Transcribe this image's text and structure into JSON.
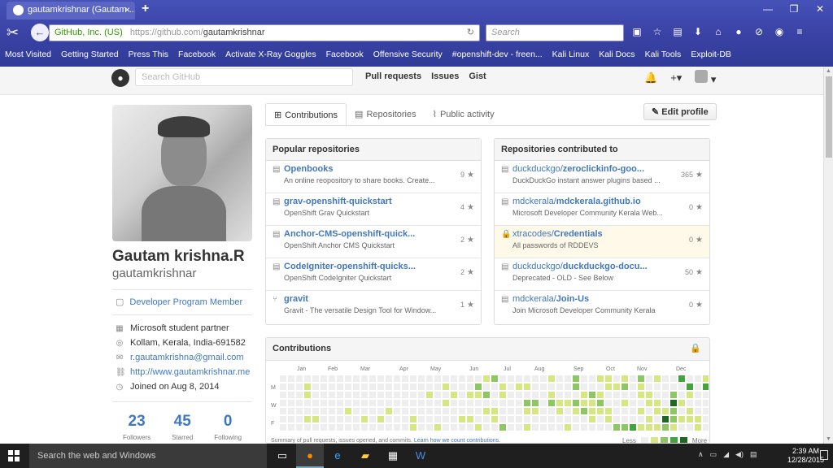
{
  "browser": {
    "tab_title": "gautamkrishnar (Gautam ...",
    "url_identity": "GitHub, Inc. (US)",
    "url_scheme_host": "https://github.com/",
    "url_path": "gautamkrishnar",
    "search_placeholder": "Search",
    "bookmarks": [
      "Most Visited",
      "Getting Started",
      "Press This",
      "Facebook",
      "Activate X-Ray Goggles",
      "Facebook",
      "Offensive Security",
      "#openshift-dev - freen...",
      "Kali Linux",
      "Kali Docs",
      "Kali Tools",
      "Exploit-DB"
    ]
  },
  "github_header": {
    "search_placeholder": "Search GitHub",
    "nav": [
      "Pull requests",
      "Issues",
      "Gist"
    ],
    "plus": "+▾"
  },
  "profile": {
    "fullname": "Gautam krishna.R",
    "username": "gautamkrishnar",
    "badge": "Developer Program Member",
    "details": [
      {
        "icon": "organization-icon",
        "text": "Microsoft student partner",
        "link": false
      },
      {
        "icon": "location-icon",
        "text": "Kollam, Kerala, India-691582",
        "link": false
      },
      {
        "icon": "mail-icon",
        "text": "r.gautamkrishna@gmail.com",
        "link": true
      },
      {
        "icon": "link-icon",
        "text": "http://www.gautamkrishnar.me",
        "link": true
      },
      {
        "icon": "clock-icon",
        "text": "Joined on Aug 8, 2014",
        "link": false
      }
    ],
    "stats": [
      {
        "value": "23",
        "label": "Followers"
      },
      {
        "value": "45",
        "label": "Starred"
      },
      {
        "value": "0",
        "label": "Following"
      }
    ]
  },
  "tabs": [
    "Contributions",
    "Repositories",
    "Public activity"
  ],
  "edit_profile": "Edit profile",
  "popular": {
    "title": "Popular repositories",
    "items": [
      {
        "name": "Openbooks",
        "desc": "An online reopository to share books. Create...",
        "stars": "9"
      },
      {
        "name": "grav-openshift-quickstart",
        "desc": "OpenShift Grav Quickstart",
        "stars": "4"
      },
      {
        "name": "Anchor-CMS-openshift-quick...",
        "desc": "OpenShift Anchor CMS Quickstart",
        "stars": "2"
      },
      {
        "name": "CodeIgniter-openshift-quicks...",
        "desc": "OpenShift CodeIgniter Quickstart",
        "stars": "2"
      },
      {
        "name": "gravit",
        "desc": "Gravit - The versatile Design Tool for Window...",
        "stars": "1"
      }
    ]
  },
  "contributed": {
    "title": "Repositories contributed to",
    "items": [
      {
        "owner": "duckduckgo/",
        "name": "zeroclickinfo-goo...",
        "desc": "DuckDuckGo instant answer plugins based ...",
        "stars": "365"
      },
      {
        "owner": "mdckerala/",
        "name": "mdckerala.github.io",
        "desc": "Microsoft Developer Community Kerala Web...",
        "stars": "0"
      },
      {
        "owner": "xtracodes/",
        "name": "Credentials",
        "desc": "All passwords of RDDEVS",
        "stars": "0"
      },
      {
        "owner": "duckduckgo/",
        "name": "duckduckgo-docu...",
        "desc": "Deprecated - OLD - See Below",
        "stars": "50"
      },
      {
        "owner": "mdckerala/",
        "name": "Join-Us",
        "desc": "Join Microsoft Developer Community Kerala",
        "stars": "0"
      }
    ]
  },
  "contributions": {
    "title": "Contributions",
    "months": [
      "Jan",
      "Feb",
      "Mar",
      "Apr",
      "May",
      "Jun",
      "Jul",
      "Aug",
      "Sep",
      "Oct",
      "Nov",
      "Dec"
    ],
    "days": [
      "M",
      "W",
      "F"
    ],
    "summary": "Summary of pull requests, issues opened, and commits.",
    "summary_link": "Learn how we count contributions.",
    "legend_less": "Less",
    "legend_more": "More",
    "colors": [
      "#eeeeee",
      "#d6e685",
      "#8cc665",
      "#44a340",
      "#1e6823"
    ]
  },
  "taskbar": {
    "search": "Search the web and Windows",
    "time": "2:39 AM",
    "date": "12/28/2015"
  }
}
